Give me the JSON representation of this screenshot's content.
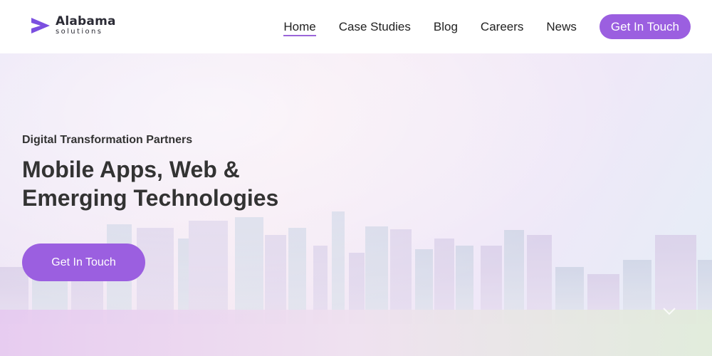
{
  "brand": {
    "name": "Alabama",
    "sub": "solutions"
  },
  "nav": {
    "items": [
      {
        "label": "Home",
        "active": true
      },
      {
        "label": "Case Studies"
      },
      {
        "label": "Blog"
      },
      {
        "label": "Careers"
      },
      {
        "label": "News"
      }
    ],
    "cta_label": "Get In Touch"
  },
  "hero": {
    "kicker": "Digital Transformation Partners",
    "title_line1": "Mobile Apps, Web &",
    "title_line2": "Emerging Technologies",
    "cta_label": "Get In Touch"
  },
  "colors": {
    "accent": "#9b5fe0",
    "text": "#333333"
  }
}
